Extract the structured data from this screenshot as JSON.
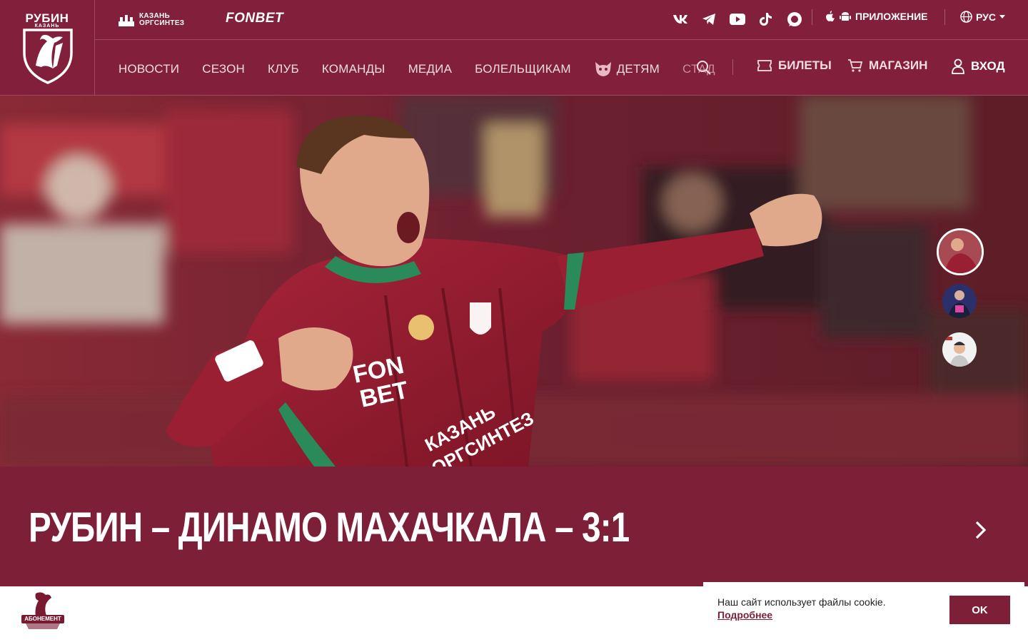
{
  "brand": {
    "name": "РУБИН",
    "city": "КАЗАНЬ"
  },
  "sponsors": {
    "primary": "КАЗАНЬ ОРГСИНТЕЗ",
    "primary_line1": "КАЗАНЬ",
    "primary_line2": "ОРГСИНТЕЗ",
    "secondary": "FONBET"
  },
  "socials": [
    "vk-icon",
    "telegram-icon",
    "youtube-icon",
    "tiktok-icon",
    "max-messenger-icon"
  ],
  "app_label": "ПРИЛОЖЕНИЕ",
  "language": "РУС",
  "nav": {
    "items": [
      "НОВОСТИ",
      "СЕЗОН",
      "КЛУБ",
      "КОМАНДЫ",
      "МЕДИА",
      "БОЛЕЛЬЩИКАМ",
      "ДЕТЯМ",
      "СТАД"
    ],
    "tickets": "БИЛЕТЫ",
    "shop": "МАГАЗИН",
    "login": "ВХОД"
  },
  "hero": {
    "title": "РУБИН – ДИНАМО МАХАЧКАЛА – 3:1",
    "jersey_text": [
      "FON",
      "BET",
      "КАЗАНЬ",
      "ОРГСИНТЕЗ"
    ]
  },
  "bottom": {
    "abonement": "АБОНЕМЕНТ"
  },
  "cookie": {
    "text": "Наш сайт использует файлы cookie.",
    "link": "Подробнее",
    "ok": "OK"
  },
  "colors": {
    "brand": "#7e1f38",
    "header": "#821f3a",
    "white": "#ffffff"
  }
}
